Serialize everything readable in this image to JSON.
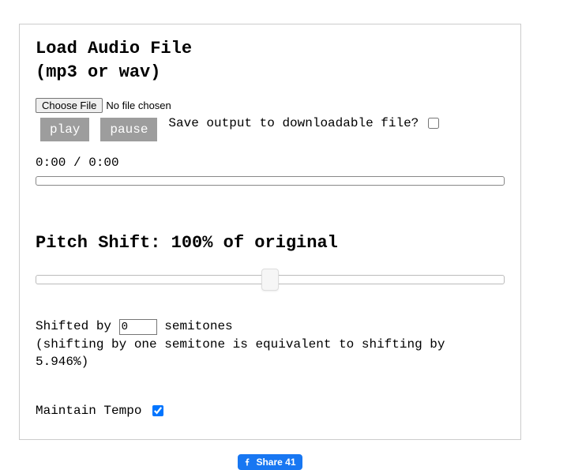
{
  "load": {
    "heading_line1": "Load Audio File",
    "heading_line2": "(mp3 or wav)",
    "choose_file_label": "Choose File",
    "file_status": "No file chosen",
    "play_label": "play",
    "pause_label": "pause",
    "save_output_label": "Save output to downloadable file?",
    "save_output_checked": false,
    "time_display": "0:00 / 0:00"
  },
  "pitch": {
    "heading": "Pitch Shift: 100% of original",
    "slider_percent": 50,
    "shifted_by_prefix": "Shifted by",
    "semitones_value": "0",
    "shifted_by_suffix": "semitones",
    "hint": "(shifting by one semitone is equivalent to shifting by 5.946%)"
  },
  "tempo": {
    "label": "Maintain Tempo",
    "checked": true
  },
  "share": {
    "label": "Share",
    "count": "41"
  }
}
